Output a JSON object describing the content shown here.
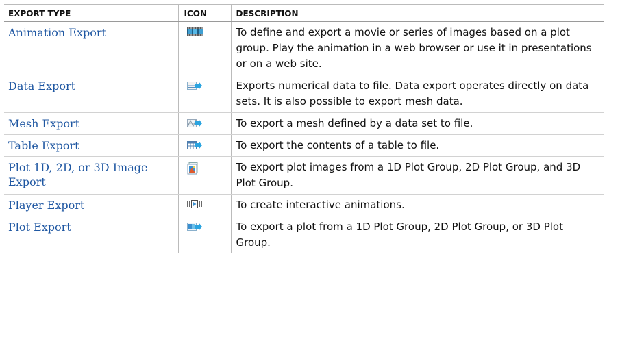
{
  "header": {
    "export_type": "EXPORT TYPE",
    "icon": "ICON",
    "description": "DESCRIPTION"
  },
  "rows": [
    {
      "type": "Animation Export",
      "icon": "animation-film-icon",
      "description": "To define and export a movie or series of images based on a plot group. Play the animation in a web browser or use it in presentations or on a web site."
    },
    {
      "type": "Data Export",
      "icon": "data-export-icon",
      "description": "Exports numerical data to file. Data export operates directly on data sets. It is also possible to export mesh data."
    },
    {
      "type": "Mesh Export",
      "icon": "mesh-export-icon",
      "description": "To export a mesh defined by a data set to file."
    },
    {
      "type": "Table Export",
      "icon": "table-export-icon",
      "description": "To export the contents of a table to file."
    },
    {
      "type": "Plot 1D, 2D, or 3D Image Export",
      "icon": "image-export-icon",
      "description": "To export plot images from a 1D Plot Group, 2D Plot Group, and 3D Plot Group."
    },
    {
      "type": "Player Export",
      "icon": "player-export-icon",
      "description": "To create interactive animations."
    },
    {
      "type": "Plot Export",
      "icon": "plot-export-icon",
      "description": "To export a plot from a 1D Plot Group, 2D Plot Group, or 3D Plot Group."
    }
  ],
  "colors": {
    "link": "#1f57a2",
    "text": "#111111",
    "rule": "#bbbbbb"
  }
}
